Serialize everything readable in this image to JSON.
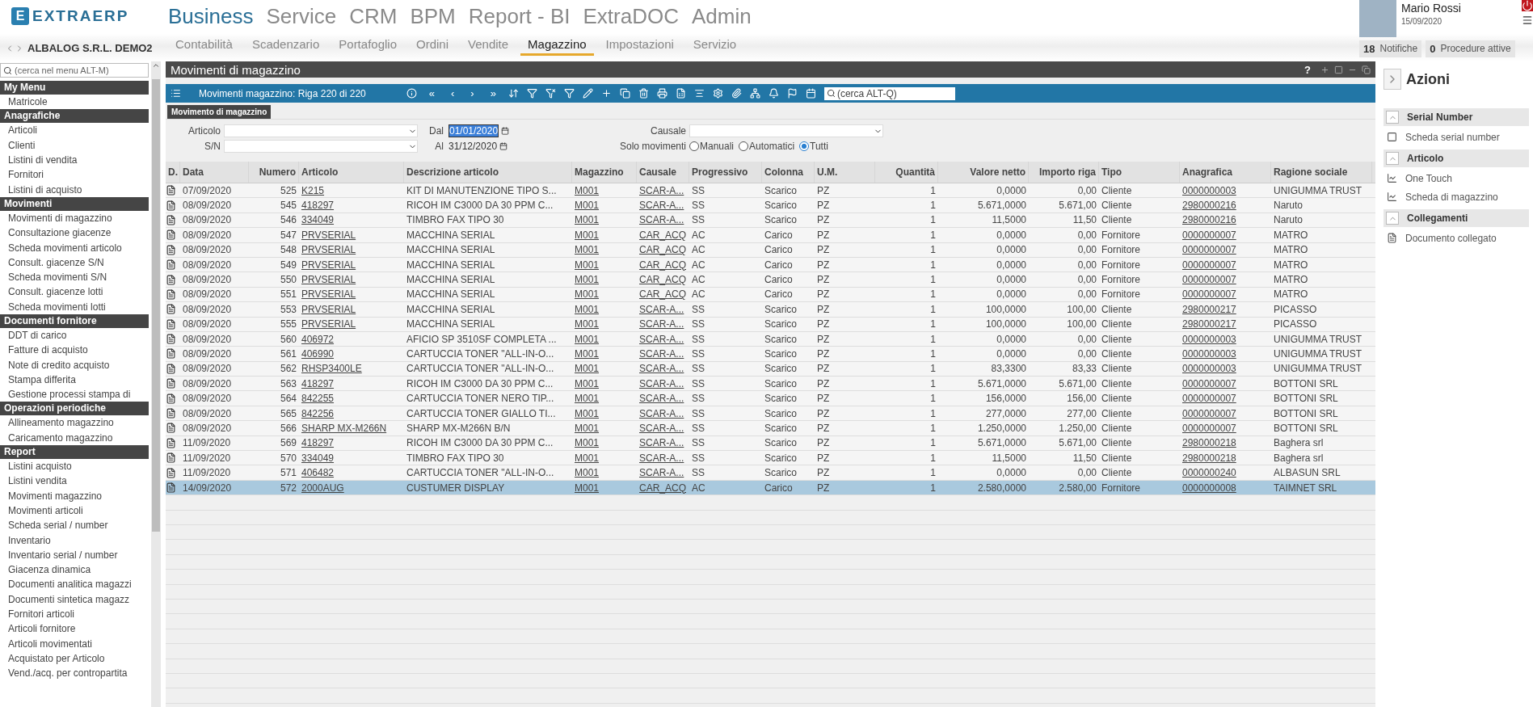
{
  "logo": {
    "letter": "E",
    "text": "EXTRAERP"
  },
  "company": "ALBALOG S.R.L. DEMO2",
  "top_nav": [
    {
      "label": "Business",
      "selected": true
    },
    {
      "label": "Service",
      "selected": false
    },
    {
      "label": "CRM",
      "selected": false
    },
    {
      "label": "BPM",
      "selected": false
    },
    {
      "label": "Report - BI",
      "selected": false
    },
    {
      "label": "ExtraDOC",
      "selected": false
    },
    {
      "label": "Admin",
      "selected": false
    }
  ],
  "sub_nav": [
    {
      "label": "Contabilità",
      "selected": false
    },
    {
      "label": "Scadenzario",
      "selected": false
    },
    {
      "label": "Portafoglio",
      "selected": false
    },
    {
      "label": "Ordini",
      "selected": false
    },
    {
      "label": "Vendite",
      "selected": false
    },
    {
      "label": "Magazzino",
      "selected": true
    },
    {
      "label": "Impostazioni",
      "selected": false
    },
    {
      "label": "Servizio",
      "selected": false
    }
  ],
  "user": {
    "name": "Mario Rossi",
    "date": "15/09/2020"
  },
  "counters": [
    {
      "count": "18",
      "label": "Notifiche"
    },
    {
      "count": "0",
      "label": "Procedure attive"
    }
  ],
  "sidebar": {
    "search_placeholder": "(cerca nel menu ALT-M)",
    "sections": [
      {
        "title": "My Menu",
        "items": [
          "Matricole"
        ]
      },
      {
        "title": "Anagrafiche",
        "items": [
          "Articoli",
          "Clienti",
          "Listini di vendita",
          "Fornitori",
          "Listini di acquisto"
        ]
      },
      {
        "title": "Movimenti",
        "items": [
          "Movimenti di magazzino",
          "Consultazione giacenze",
          "Scheda movimenti articolo",
          "Consult. giacenze S/N",
          "Scheda movimenti S/N",
          "Consult. giacenze lotti",
          "Scheda movimenti lotti"
        ]
      },
      {
        "title": "Documenti fornitore",
        "items": [
          "DDT di carico",
          "Fatture di acquisto",
          "Note di credito acquisto",
          "Stampa differita",
          "Gestione processi stampa di"
        ]
      },
      {
        "title": "Operazioni periodiche",
        "items": [
          "Allineamento magazzino",
          "Caricamento magazzino"
        ]
      },
      {
        "title": "Report",
        "items": [
          "Listini acquisto",
          "Listini vendita",
          "Movimenti magazzino",
          "Movimenti articoli",
          "Scheda serial / number",
          "Inventario",
          "Inventario serial / number",
          "Giacenza dinamica",
          "Documenti analitica magazzi",
          "Documenti sintetica magazz",
          "Fornitori articoli",
          "Articoli fornitore",
          "Articoli movimentati",
          "Acquistato per Articolo",
          "Vend./acq. per contropartita"
        ]
      }
    ]
  },
  "window": {
    "title": "Movimenti di magazzino",
    "help": "?"
  },
  "toolbar": {
    "title": "Movimenti magazzino: Riga 220 di 220",
    "nav": [
      "«",
      "‹",
      "›",
      "»"
    ],
    "search_placeholder": "(cerca ALT-Q)"
  },
  "form_tab": "Movimento di magazzino",
  "filters": {
    "articolo_label": "Articolo",
    "sn_label": "S/N",
    "dal_label": "Dal",
    "dal_value": "01/01/2020",
    "al_label": "Al",
    "al_value": "31/12/2020",
    "causale_label": "Causale",
    "solo_label": "Solo movimenti",
    "options": [
      {
        "label": "Manuali",
        "selected": false
      },
      {
        "label": "Automatici",
        "selected": false
      },
      {
        "label": "Tutti",
        "selected": true
      }
    ]
  },
  "table": {
    "columns": [
      "D.",
      "Data",
      "Numero",
      "Articolo",
      "Descrizione articolo",
      "Magazzino",
      "Causale",
      "Progressivo",
      "Colonna",
      "U.M.",
      "Quantità",
      "Valore netto",
      "Importo riga",
      "Tipo",
      "Anagrafica",
      "Ragione sociale"
    ],
    "rows": [
      {
        "selected": false,
        "cells": [
          "",
          "07/09/2020",
          "525",
          "K215",
          "KIT DI MANUTENZIONE TIPO S...",
          "M001",
          "SCAR-A...",
          "SS",
          "Scarico",
          "PZ",
          "1",
          "0,0000",
          "0,00",
          "Cliente",
          "0000000003",
          "UNIGUMMA TRUST"
        ]
      },
      {
        "selected": false,
        "cells": [
          "",
          "08/09/2020",
          "545",
          "418297",
          "RICOH IM C3000 DA 30 PPM C...",
          "M001",
          "SCAR-A...",
          "SS",
          "Scarico",
          "PZ",
          "1",
          "5.671,0000",
          "5.671,00",
          "Cliente",
          "2980000216",
          "Naruto"
        ]
      },
      {
        "selected": false,
        "cells": [
          "",
          "08/09/2020",
          "546",
          "334049",
          "TIMBRO FAX TIPO 30",
          "M001",
          "SCAR-A...",
          "SS",
          "Scarico",
          "PZ",
          "1",
          "11,5000",
          "11,50",
          "Cliente",
          "2980000216",
          "Naruto"
        ]
      },
      {
        "selected": false,
        "cells": [
          "",
          "08/09/2020",
          "547",
          "PRVSERIAL",
          "MACCHINA SERIAL",
          "M001",
          "CAR_ACQ",
          "AC",
          "Carico",
          "PZ",
          "1",
          "0,0000",
          "0,00",
          "Fornitore",
          "0000000007",
          "MATRO"
        ]
      },
      {
        "selected": false,
        "cells": [
          "",
          "08/09/2020",
          "548",
          "PRVSERIAL",
          "MACCHINA SERIAL",
          "M001",
          "CAR_ACQ",
          "AC",
          "Carico",
          "PZ",
          "1",
          "0,0000",
          "0,00",
          "Fornitore",
          "0000000007",
          "MATRO"
        ]
      },
      {
        "selected": false,
        "cells": [
          "",
          "08/09/2020",
          "549",
          "PRVSERIAL",
          "MACCHINA SERIAL",
          "M001",
          "CAR_ACQ",
          "AC",
          "Carico",
          "PZ",
          "1",
          "0,0000",
          "0,00",
          "Fornitore",
          "0000000007",
          "MATRO"
        ]
      },
      {
        "selected": false,
        "cells": [
          "",
          "08/09/2020",
          "550",
          "PRVSERIAL",
          "MACCHINA SERIAL",
          "M001",
          "CAR_ACQ",
          "AC",
          "Carico",
          "PZ",
          "1",
          "0,0000",
          "0,00",
          "Fornitore",
          "0000000007",
          "MATRO"
        ]
      },
      {
        "selected": false,
        "cells": [
          "",
          "08/09/2020",
          "551",
          "PRVSERIAL",
          "MACCHINA SERIAL",
          "M001",
          "CAR_ACQ",
          "AC",
          "Carico",
          "PZ",
          "1",
          "0,0000",
          "0,00",
          "Fornitore",
          "0000000007",
          "MATRO"
        ]
      },
      {
        "selected": false,
        "cells": [
          "",
          "08/09/2020",
          "553",
          "PRVSERIAL",
          "MACCHINA SERIAL",
          "M001",
          "SCAR-A...",
          "SS",
          "Scarico",
          "PZ",
          "1",
          "100,0000",
          "100,00",
          "Cliente",
          "2980000217",
          "PICASSO"
        ]
      },
      {
        "selected": false,
        "cells": [
          "",
          "08/09/2020",
          "555",
          "PRVSERIAL",
          "MACCHINA SERIAL",
          "M001",
          "SCAR-A...",
          "SS",
          "Scarico",
          "PZ",
          "1",
          "100,0000",
          "100,00",
          "Cliente",
          "2980000217",
          "PICASSO"
        ]
      },
      {
        "selected": false,
        "cells": [
          "",
          "08/09/2020",
          "560",
          "406972",
          "AFICIO SP 3510SF COMPLETA ...",
          "M001",
          "SCAR-A...",
          "SS",
          "Scarico",
          "PZ",
          "1",
          "0,0000",
          "0,00",
          "Cliente",
          "0000000003",
          "UNIGUMMA TRUST"
        ]
      },
      {
        "selected": false,
        "cells": [
          "",
          "08/09/2020",
          "561",
          "406990",
          "CARTUCCIA TONER \"ALL-IN-O...",
          "M001",
          "SCAR-A...",
          "SS",
          "Scarico",
          "PZ",
          "1",
          "0,0000",
          "0,00",
          "Cliente",
          "0000000003",
          "UNIGUMMA TRUST"
        ]
      },
      {
        "selected": false,
        "cells": [
          "",
          "08/09/2020",
          "562",
          "RHSP3400LE",
          "CARTUCCIA TONER \"ALL-IN-O...",
          "M001",
          "SCAR-A...",
          "SS",
          "Scarico",
          "PZ",
          "1",
          "83,3300",
          "83,33",
          "Cliente",
          "0000000003",
          "UNIGUMMA TRUST"
        ]
      },
      {
        "selected": false,
        "cells": [
          "",
          "08/09/2020",
          "563",
          "418297",
          "RICOH IM C3000 DA 30 PPM C...",
          "M001",
          "SCAR-A...",
          "SS",
          "Scarico",
          "PZ",
          "1",
          "5.671,0000",
          "5.671,00",
          "Cliente",
          "0000000007",
          "BOTTONI SRL"
        ]
      },
      {
        "selected": false,
        "cells": [
          "",
          "08/09/2020",
          "564",
          "842255",
          "CARTUCCIA TONER NERO TIP...",
          "M001",
          "SCAR-A...",
          "SS",
          "Scarico",
          "PZ",
          "1",
          "156,0000",
          "156,00",
          "Cliente",
          "0000000007",
          "BOTTONI SRL"
        ]
      },
      {
        "selected": false,
        "cells": [
          "",
          "08/09/2020",
          "565",
          "842256",
          "CARTUCCIA TONER GIALLO TI...",
          "M001",
          "SCAR-A...",
          "SS",
          "Scarico",
          "PZ",
          "1",
          "277,0000",
          "277,00",
          "Cliente",
          "0000000007",
          "BOTTONI SRL"
        ]
      },
      {
        "selected": false,
        "cells": [
          "",
          "08/09/2020",
          "566",
          "SHARP MX-M266N",
          "SHARP MX-M266N B/N",
          "M001",
          "SCAR-A...",
          "SS",
          "Scarico",
          "PZ",
          "1",
          "1.250,0000",
          "1.250,00",
          "Cliente",
          "0000000007",
          "BOTTONI SRL"
        ]
      },
      {
        "selected": false,
        "cells": [
          "",
          "11/09/2020",
          "569",
          "418297",
          "RICOH IM C3000 DA 30 PPM C...",
          "M001",
          "SCAR-A...",
          "SS",
          "Scarico",
          "PZ",
          "1",
          "5.671,0000",
          "5.671,00",
          "Cliente",
          "2980000218",
          "Baghera srl"
        ]
      },
      {
        "selected": false,
        "cells": [
          "",
          "11/09/2020",
          "570",
          "334049",
          "TIMBRO FAX TIPO 30",
          "M001",
          "SCAR-A...",
          "SS",
          "Scarico",
          "PZ",
          "1",
          "11,5000",
          "11,50",
          "Cliente",
          "2980000218",
          "Baghera srl"
        ]
      },
      {
        "selected": false,
        "cells": [
          "",
          "11/09/2020",
          "571",
          "406482",
          "CARTUCCIA TONER \"ALL-IN-O...",
          "M001",
          "SCAR-A...",
          "SS",
          "Scarico",
          "PZ",
          "1",
          "0,0000",
          "0,00",
          "Cliente",
          "0000000240",
          "ALBASUN SRL"
        ]
      },
      {
        "selected": true,
        "cells": [
          "",
          "14/09/2020",
          "572",
          "2000AUG",
          "CUSTUMER DISPLAY",
          "M001",
          "CAR_ACQ",
          "AC",
          "Carico",
          "PZ",
          "1",
          "2.580,0000",
          "2.580,00",
          "Fornitore",
          "0000000008",
          "TAIMNET SRL"
        ]
      }
    ]
  },
  "actions": {
    "title": "Azioni",
    "sections": [
      {
        "title": "Serial Number",
        "items": [
          {
            "label": "Scheda serial number",
            "kind": "box"
          }
        ]
      },
      {
        "title": "Articolo",
        "items": [
          {
            "label": "One Touch",
            "kind": "chart"
          },
          {
            "label": "Scheda di magazzino",
            "kind": "chart"
          }
        ]
      },
      {
        "title": "Collegamenti",
        "items": [
          {
            "label": "Documento collegato",
            "kind": "doc"
          }
        ]
      }
    ]
  }
}
